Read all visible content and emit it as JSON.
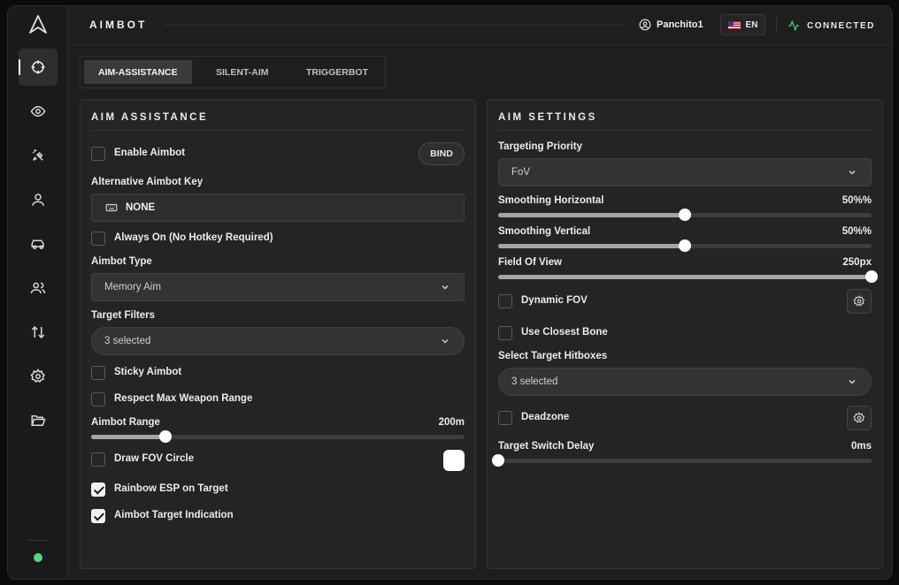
{
  "header": {
    "title": "AIMBOT",
    "username": "Panchito1",
    "language": "EN",
    "status": "CONNECTED"
  },
  "sidebar": {
    "items": [
      {
        "icon": "crosshair-icon",
        "active": true
      },
      {
        "icon": "eye-icon",
        "active": false
      },
      {
        "icon": "sparkle-tool-icon",
        "active": false
      },
      {
        "icon": "user-icon",
        "active": false
      },
      {
        "icon": "car-icon",
        "active": false
      },
      {
        "icon": "users-icon",
        "active": false
      },
      {
        "icon": "arrows-up-down-icon",
        "active": false
      },
      {
        "icon": "gear-icon",
        "active": false
      },
      {
        "icon": "folder-open-icon",
        "active": false
      }
    ],
    "status_color": "#4ade80"
  },
  "tabs": [
    {
      "label": "AIM-ASSISTANCE",
      "active": true
    },
    {
      "label": "SILENT-AIM",
      "active": false
    },
    {
      "label": "TRIGGERBOT",
      "active": false
    }
  ],
  "assist": {
    "title": "AIM ASSISTANCE",
    "enable_label": "Enable Aimbot",
    "enable_checked": false,
    "bind_label": "BIND",
    "alt_key_label": "Alternative Aimbot Key",
    "alt_key_value": "NONE",
    "always_on_label": "Always On (No Hotkey Required)",
    "always_on_checked": false,
    "type_label": "Aimbot Type",
    "type_value": "Memory Aim",
    "filters_label": "Target Filters",
    "filters_value": "3 selected",
    "sticky_label": "Sticky Aimbot",
    "sticky_checked": false,
    "respect_label": "Respect Max Weapon Range",
    "respect_checked": false,
    "range_label": "Aimbot Range",
    "range_value": "200m",
    "range_fraction": 0.2,
    "fov_circle_label": "Draw FOV Circle",
    "fov_circle_checked": false,
    "fov_circle_color": "#ffffff",
    "rainbow_label": "Rainbow ESP on Target",
    "rainbow_checked": true,
    "indication_label": "Aimbot Target Indication",
    "indication_checked": true
  },
  "settings": {
    "title": "AIM SETTINGS",
    "priority_label": "Targeting Priority",
    "priority_value": "FoV",
    "smooth_h_label": "Smoothing Horizontal",
    "smooth_h_value": "50%%",
    "smooth_h_fraction": 0.5,
    "smooth_v_label": "Smoothing Vertical",
    "smooth_v_value": "50%%",
    "smooth_v_fraction": 0.5,
    "fov_label": "Field Of View",
    "fov_value": "250px",
    "fov_fraction": 1.0,
    "dynamic_fov_label": "Dynamic FOV",
    "dynamic_fov_checked": false,
    "closest_bone_label": "Use Closest Bone",
    "closest_bone_checked": false,
    "hitboxes_label": "Select Target Hitboxes",
    "hitboxes_value": "3 selected",
    "deadzone_label": "Deadzone",
    "deadzone_checked": false,
    "switch_delay_label": "Target Switch Delay",
    "switch_delay_value": "0ms",
    "switch_delay_fraction": 0.0
  }
}
